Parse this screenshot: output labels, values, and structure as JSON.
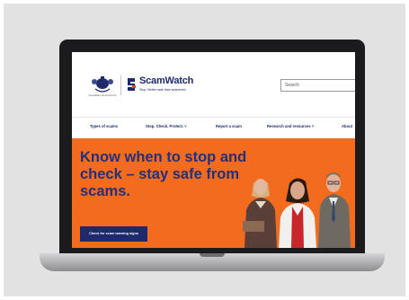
{
  "site": {
    "gov_caption": "Australian Government",
    "brand_name": "ScamWatch",
    "tagline": "Stop. Better safe than scammed."
  },
  "search": {
    "placeholder": "Search"
  },
  "nav": {
    "items": [
      {
        "label": "Types of scams"
      },
      {
        "label": "Stop. Check. Protect. ˅"
      },
      {
        "label": "Report a scam"
      },
      {
        "label": "Research and resources ˅"
      },
      {
        "label": "About"
      }
    ]
  },
  "hero": {
    "title": "Know when to stop and check – stay safe from scams.",
    "cta_label": "Check for scam warning signs"
  },
  "colors": {
    "hero_background": "#f26b1f",
    "brand_navy": "#1f2a6e",
    "laptop_bezel": "#1b1b1d"
  }
}
